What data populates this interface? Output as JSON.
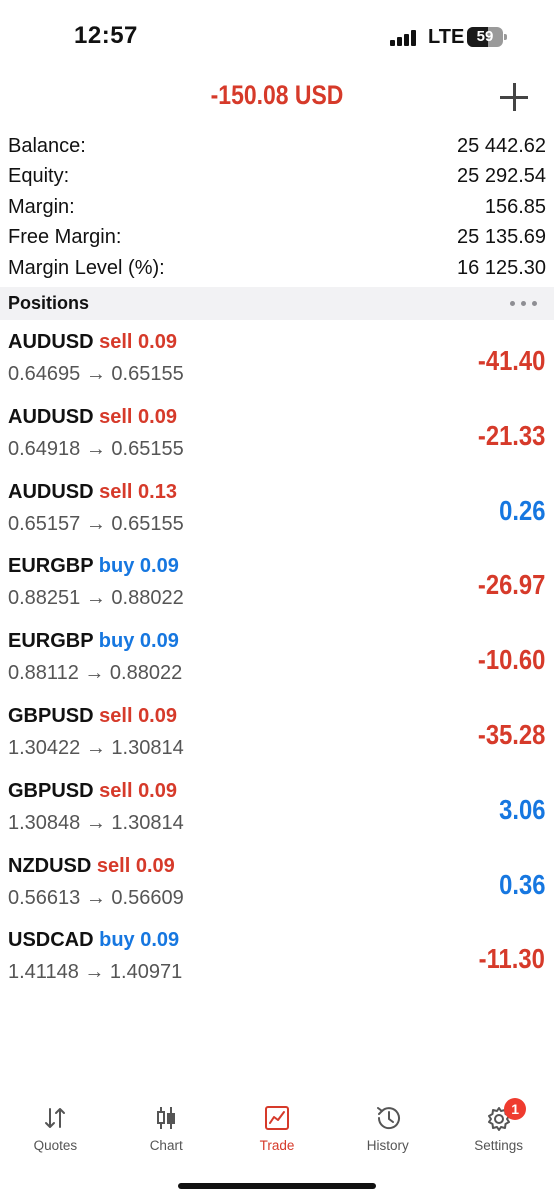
{
  "status_bar": {
    "time": "12:57",
    "network": "LTE",
    "battery_level": "59",
    "battery_fraction": 0.59,
    "signal_bars": 4
  },
  "header": {
    "total_pl": "-150.08 USD",
    "add_icon": "plus-icon"
  },
  "summary": [
    {
      "label": "Balance:",
      "value": "25 442.62"
    },
    {
      "label": "Equity:",
      "value": "25 292.54"
    },
    {
      "label": "Margin:",
      "value": "156.85"
    },
    {
      "label": "Free Margin:",
      "value": "25 135.69"
    },
    {
      "label": "Margin Level (%):",
      "value": "16 125.30"
    }
  ],
  "positions_section": {
    "title": "Positions",
    "menu_icon": "more-horizontal-icon"
  },
  "positions": [
    {
      "symbol": "AUDUSD",
      "side": "sell",
      "volume": "0.09",
      "prices": "0.64695 → 0.65155",
      "profit": "-41.40"
    },
    {
      "symbol": "AUDUSD",
      "side": "sell",
      "volume": "0.09",
      "prices": "0.64918 → 0.65155",
      "profit": "-21.33"
    },
    {
      "symbol": "AUDUSD",
      "side": "sell",
      "volume": "0.13",
      "prices": "0.65157 → 0.65155",
      "profit": "0.26"
    },
    {
      "symbol": "EURGBP",
      "side": "buy",
      "volume": "0.09",
      "prices": "0.88251 → 0.88022",
      "profit": "-26.97"
    },
    {
      "symbol": "EURGBP",
      "side": "buy",
      "volume": "0.09",
      "prices": "0.88112 → 0.88022",
      "profit": "-10.60"
    },
    {
      "symbol": "GBPUSD",
      "side": "sell",
      "volume": "0.09",
      "prices": "1.30422 → 1.30814",
      "profit": "-35.28"
    },
    {
      "symbol": "GBPUSD",
      "side": "sell",
      "volume": "0.09",
      "prices": "1.30848 → 1.30814",
      "profit": "3.06"
    },
    {
      "symbol": "NZDUSD",
      "side": "sell",
      "volume": "0.09",
      "prices": "0.56613 → 0.56609",
      "profit": "0.36"
    },
    {
      "symbol": "USDCAD",
      "side": "buy",
      "volume": "0.09",
      "prices": "1.41148 → 1.40971",
      "profit": "-11.30"
    }
  ],
  "tabs": [
    {
      "label": "Quotes",
      "icon": "quotes-arrows-icon",
      "active": false
    },
    {
      "label": "Chart",
      "icon": "candlestick-chart-icon",
      "active": false
    },
    {
      "label": "Trade",
      "icon": "trade-chart-icon",
      "active": true
    },
    {
      "label": "History",
      "icon": "history-clock-icon",
      "active": false
    },
    {
      "label": "Settings",
      "icon": "gear-icon",
      "active": false,
      "badge": "1"
    }
  ],
  "colors": {
    "loss": "#d63a2a",
    "gain": "#1677e0",
    "sell": "#d63a2a",
    "buy": "#1677e0",
    "badge": "#ef3b2f"
  }
}
